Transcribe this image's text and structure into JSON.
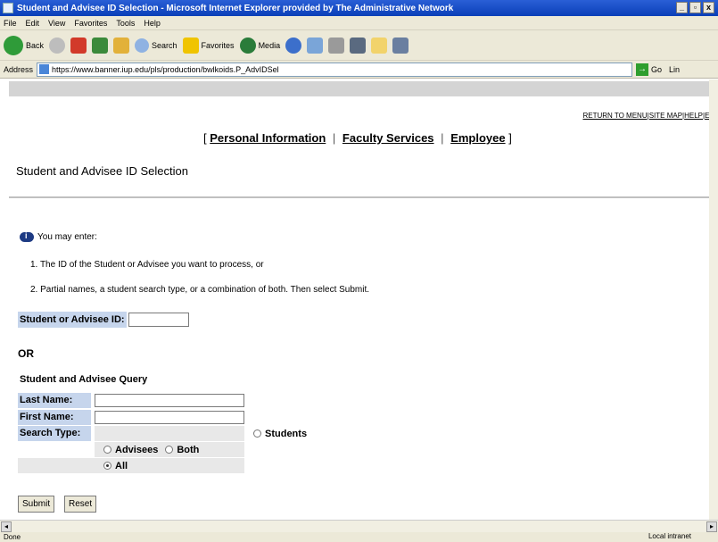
{
  "window": {
    "title": "Student and Advisee ID Selection - Microsoft Internet Explorer provided by The Administrative Network",
    "minimize": "_",
    "restore": "▫",
    "close": "x"
  },
  "menu": [
    "File",
    "Edit",
    "View",
    "Favorites",
    "Tools",
    "Help"
  ],
  "toolbar": {
    "back": "Back",
    "search": "Search",
    "favorites": "Favorites",
    "media": "Media"
  },
  "address": {
    "label": "Address",
    "url": "https://www.banner.iup.edu/pls/production/bwlkoids.P_AdvIDSel",
    "go": "Go",
    "links": "Lin"
  },
  "page": {
    "top_links": {
      "return": "RETURN TO MENU",
      "sep1": "|",
      "sitemap": "SITE MAP",
      "sep2": "|",
      "help": "HELP",
      "sep3": "|",
      "exit": "EXI"
    },
    "nav": {
      "open": "[",
      "personal": "Personal Information",
      "sep1": "|",
      "faculty": "Faculty Services",
      "sep2": "|",
      "employee": "Employee",
      "close": "]"
    },
    "title": "Student and Advisee ID Selection",
    "info": "You may enter:",
    "step1": "1. The ID of the Student or Advisee you want to process, or",
    "step2": "2. Partial names, a student search type, or a combination of both. Then select Submit.",
    "id_label": "Student or Advisee ID:",
    "or": "OR",
    "query_title": "Student and Advisee Query",
    "last_name_label": "Last Name:",
    "first_name_label": "First Name:",
    "search_type_label": "Search Type:",
    "radio_students": "Students",
    "radio_advisees": "Advisees",
    "radio_both": "Both",
    "radio_all": "All",
    "submit": "Submit",
    "reset": "Reset"
  },
  "status": {
    "text": "Done",
    "zone": "Local intranet"
  }
}
